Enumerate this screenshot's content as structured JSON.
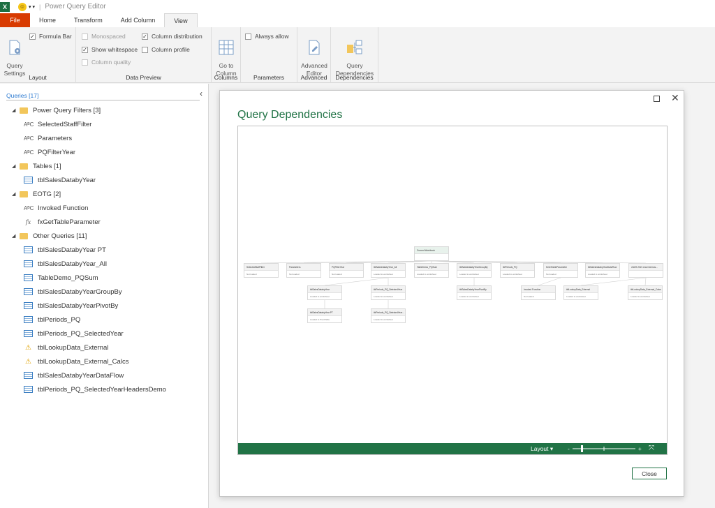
{
  "window": {
    "app_icon": "X",
    "title": "Power Query Editor"
  },
  "tabs": [
    {
      "label": "File"
    },
    {
      "label": "Home"
    },
    {
      "label": "Transform"
    },
    {
      "label": "Add Column"
    },
    {
      "label": "View"
    }
  ],
  "ribbon": {
    "layout": {
      "label": "Layout",
      "query_settings": "Query\nSettings",
      "formula_bar": "Formula Bar"
    },
    "data_preview": {
      "label": "Data Preview",
      "monospaced": "Monospaced",
      "show_whitespace": "Show whitespace",
      "column_quality": "Column quality",
      "column_distribution": "Column distribution",
      "column_profile": "Column profile"
    },
    "columns": {
      "label": "Columns",
      "go_to_column": "Go to\nColumn"
    },
    "parameters": {
      "label": "Parameters",
      "always_allow": "Always allow"
    },
    "advanced": {
      "label": "Advanced",
      "advanced_editor": "Advanced\nEditor"
    },
    "dependencies": {
      "label": "Dependencies",
      "query_dependencies": "Query\nDependencies"
    }
  },
  "queries": {
    "header": "Queries [17]",
    "items": [
      {
        "type": "folder",
        "label": "Power Query Filters [3]"
      },
      {
        "type": "text",
        "icon": "text-type-icon",
        "glyph": "AᴮC",
        "label": "SelectedStaffFilter"
      },
      {
        "type": "text",
        "icon": "text-type-icon",
        "glyph": "AᴮC",
        "label": "Parameters"
      },
      {
        "type": "text",
        "icon": "text-type-icon",
        "glyph": "AᴮC",
        "label": "PQFilterYear"
      },
      {
        "type": "folder",
        "label": "Tables [1]"
      },
      {
        "type": "table",
        "icon": "table-icon",
        "label": "tblSalesDatabyYear"
      },
      {
        "type": "folder",
        "label": "EOTG [2]"
      },
      {
        "type": "text",
        "icon": "text-type-icon",
        "glyph": "AᴮC",
        "label": "Invoked Function"
      },
      {
        "type": "fx",
        "icon": "function-icon",
        "glyph": "fx",
        "label": "fxGetTableParameter"
      },
      {
        "type": "folder",
        "label": "Other Queries [11]"
      },
      {
        "type": "table",
        "icon": "table-icon",
        "label": "tblSalesDatabyYear PT"
      },
      {
        "type": "table",
        "icon": "table-icon",
        "label": "tblSalesDatabyYear_All"
      },
      {
        "type": "table",
        "icon": "table-icon",
        "label": "TableDemo_PQSum"
      },
      {
        "type": "table",
        "icon": "table-icon",
        "label": "tblSalesDatabyYearGroupBy"
      },
      {
        "type": "table",
        "icon": "table-icon",
        "label": "tblSalesDatabyYearPivotBy"
      },
      {
        "type": "table",
        "icon": "table-icon",
        "label": "tblPeriods_PQ"
      },
      {
        "type": "table",
        "icon": "table-icon",
        "label": "tblPeriods_PQ_SelectedYear"
      },
      {
        "type": "warn",
        "icon": "warning-icon",
        "glyph": "⚠",
        "label": "tblLookupData_External"
      },
      {
        "type": "warn",
        "icon": "warning-icon",
        "glyph": "⚠",
        "label": "tblLookupData_External_Calcs"
      },
      {
        "type": "table",
        "icon": "table-icon",
        "label": "tblSalesDatabyYearDataFlow"
      },
      {
        "type": "table",
        "icon": "table-icon",
        "label": "tblPeriods_PQ_SelectedYearHeadersDemo"
      }
    ]
  },
  "dialog": {
    "title": "Query Dependencies",
    "close_label": "Close",
    "layout_label": "Layout",
    "zoom_minus": "-",
    "zoom_plus": "+",
    "root": {
      "title": "Current Workbook"
    },
    "row1": [
      {
        "title": "SelectedStaffFilter",
        "sub": "Not loaded"
      },
      {
        "title": "Parameters",
        "sub": "Not loaded"
      },
      {
        "title": "PQFilterYear",
        "sub": "Not loaded"
      },
      {
        "title": "tblSalesDatabyYear_All",
        "sub": "Loaded to worksheet"
      },
      {
        "title": "TableDemo_PQSum",
        "sub": "Loaded to worksheet"
      },
      {
        "title": "tblSalesDatabyYearGroupBy",
        "sub": "Loaded to worksheet"
      },
      {
        "title": "tblPeriods_PQ",
        "sub": "Loaded to worksheet"
      },
      {
        "title": "fxGetTableParameter",
        "sub": "Not loaded"
      },
      {
        "title": "tblSalesDatabyYearDataFlow",
        "sub": "Loaded to worksheet"
      },
      {
        "title": "d:\\MS 2021 excel demos...",
        "sub": ""
      }
    ],
    "row2": [
      {
        "title": "tblSalesDatabyYear",
        "sub": "Loaded to worksheet"
      },
      {
        "title": "tblPeriods_PQ_SelectedYear",
        "sub": "Loaded to worksheet"
      },
      {
        "title": "tblSalesDatabyYearPivotBy",
        "sub": "Loaded to worksheet"
      },
      {
        "title": "Invoked Function",
        "sub": "Not loaded"
      },
      {
        "title": "tblLookupData_External",
        "sub": "Loaded to worksheet"
      },
      {
        "title": "tblLookupData_External_Calcs",
        "sub": "Loaded to worksheet"
      }
    ],
    "row3": [
      {
        "title": "tblSalesDatabyYear PT",
        "sub": "Loaded to PivotTable"
      },
      {
        "title": "tblPeriods_PQ_SelectedYear...",
        "sub": "Loaded to worksheet"
      }
    ]
  }
}
